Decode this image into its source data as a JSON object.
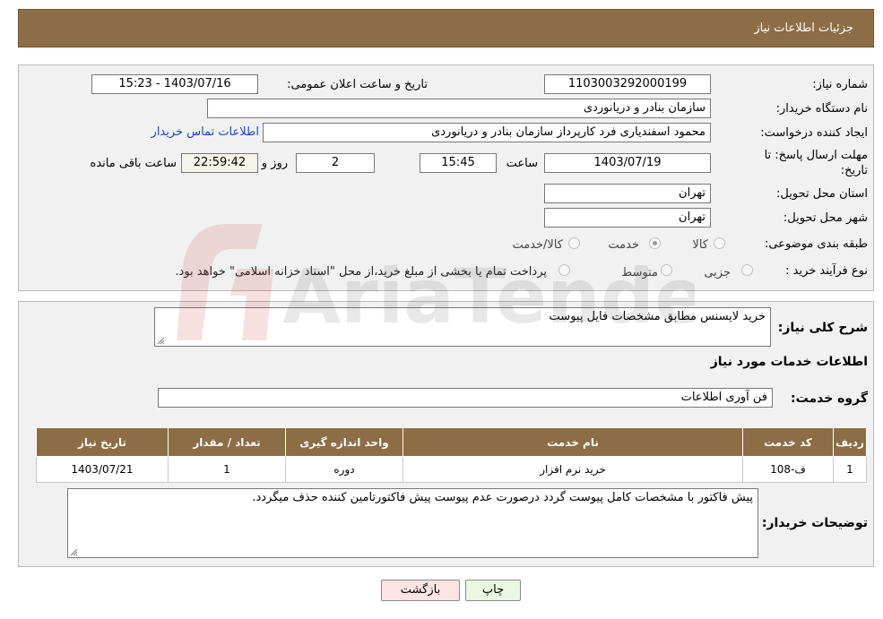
{
  "header": {
    "title": "جزئیات اطلاعات نیاز"
  },
  "need_info": {
    "need_number_label": "شماره نیاز:",
    "need_number": "1103003292000199",
    "announce_label": "تاریخ و ساعت اعلان عمومی:",
    "announce_value": "1403/07/16 - 15:23",
    "buyer_org_label": "نام دستگاه خریدار:",
    "buyer_org": "سازمان بنادر و دریانوردی",
    "creator_label": "ایجاد کننده درخواست:",
    "creator": "محمود اسفندیاری فرد کارپرداز سازمان بنادر و دریانوردی",
    "contact_link": "اطلاعات تماس خریدار",
    "deadline_label_1": "مهلت ارسال پاسخ: تا",
    "deadline_label_2": "تاریخ:",
    "deadline_date": "1403/07/19",
    "time_label": "ساعت",
    "deadline_time": "15:45",
    "days_value": "2",
    "days_label": "روز و",
    "remaining_time": "22:59:42",
    "remaining_label": "ساعت باقی مانده",
    "province_label": "استان محل تحویل:",
    "province": "تهران",
    "city_label": "شهر محل تحویل:",
    "city": "تهران",
    "category_label": "طبقه بندی موضوعی:",
    "category_options": [
      "کالا",
      "خدمت",
      "کالا/خدمت"
    ],
    "category_selected": "خدمت",
    "process_label": "نوع فرآیند خرید :",
    "process_options": [
      "جزیی",
      "متوسط"
    ],
    "process_note": "پرداخت تمام یا بخشی از مبلغ خرید،از محل \"اسناد خزانه اسلامی\" خواهد بود."
  },
  "details": {
    "summary_label": "شرح کلی نیاز:",
    "summary": "خرید لایسنس مطابق مشخصات فایل پیوست",
    "services_heading": "اطلاعات خدمات مورد نیاز",
    "service_group_label": "گروه خدمت:",
    "service_group": "فن آوری اطلاعات",
    "table": {
      "headers": [
        "ردیف",
        "کد خدمت",
        "نام خدمت",
        "واحد اندازه گیری",
        "تعداد / مقدار",
        "تاریخ نیاز"
      ],
      "rows": [
        [
          "1",
          "ف-108",
          "خرید نرم افزار",
          "دوره",
          "1",
          "1403/07/21"
        ]
      ]
    },
    "buyer_notes_label": "توضیحات خریدار:",
    "buyer_notes": "پیش فاکتور با مشخصات کامل  پیوست گردد درصورت عدم پیوست پیش فاکتورتامین کننده حذف میگردد."
  },
  "actions": {
    "print": "چاپ",
    "back": "بازگشت"
  },
  "watermark": {
    "text": "AriaTender.neT"
  },
  "colors": {
    "header": "#8c6d45",
    "link": "#1a44c8",
    "back_button": "#fce4e4",
    "print_button": "#eaf7e2"
  }
}
